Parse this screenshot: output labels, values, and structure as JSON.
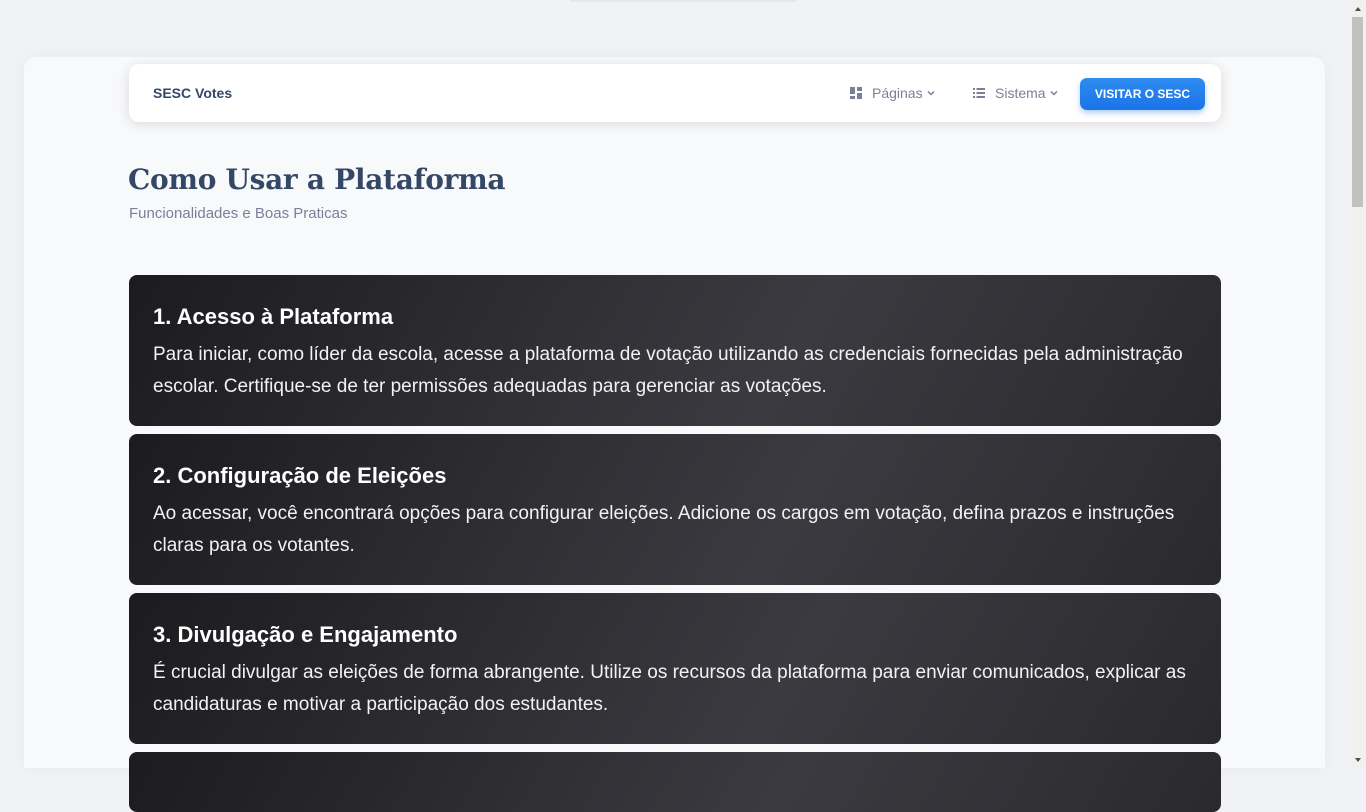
{
  "navbar": {
    "brand": "SESC Votes",
    "pages_label": "Páginas",
    "pages_icon": "dashboard-icon",
    "system_label": "Sistema",
    "system_icon": "list-icon",
    "cta_label": "VISITAR O SESC"
  },
  "header": {
    "title": "Como Usar a Plataforma",
    "subtitle": "Funcionalidades e Boas Praticas"
  },
  "cards": [
    {
      "title": "1. Acesso à Plataforma",
      "text": "Para iniciar, como líder da escola, acesse a plataforma de votação utilizando as credenciais fornecidas pela administração escolar. Certifique-se de ter permissões adequadas para gerenciar as votações."
    },
    {
      "title": "2. Configuração de Eleições",
      "text": "Ao acessar, você encontrará opções para configurar eleições. Adicione os cargos em votação, defina prazos e instruções claras para os votantes."
    },
    {
      "title": "3. Divulgação e Engajamento",
      "text": "É crucial divulgar as eleições de forma abrangente. Utilize os recursos da plataforma para enviar comunicados, explicar as candidaturas e motivar a participação dos estudantes."
    }
  ],
  "colors": {
    "accent": "#1a73e8",
    "heading": "#344767",
    "muted": "#7b809a",
    "card_dark": "#2a2a2e"
  }
}
